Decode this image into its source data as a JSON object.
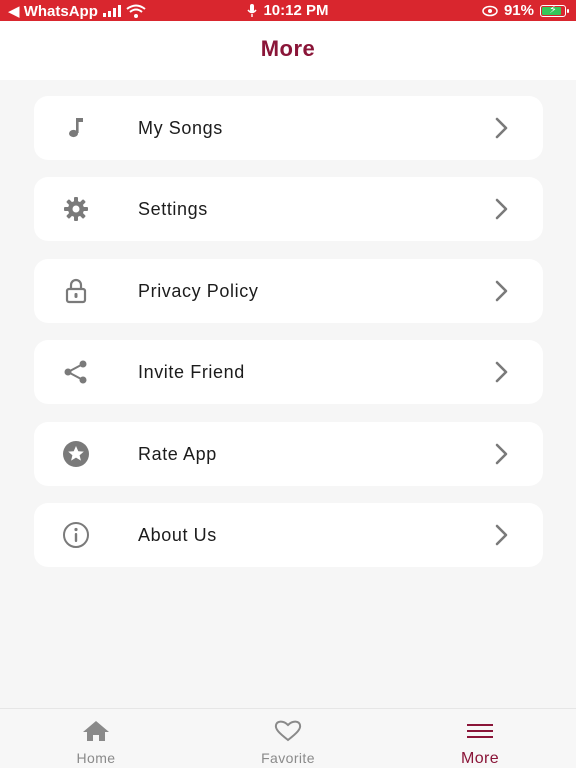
{
  "status_bar": {
    "back_app": "◀ WhatsApp",
    "time": "10:12 PM",
    "battery": "91%",
    "battery_level": 0.91
  },
  "header": {
    "title": "More"
  },
  "menu": {
    "items": [
      {
        "label": "My Songs",
        "icon": "music-note-icon"
      },
      {
        "label": "Settings",
        "icon": "gear-icon"
      },
      {
        "label": "Privacy Policy",
        "icon": "lock-icon"
      },
      {
        "label": "Invite Friend",
        "icon": "share-icon"
      },
      {
        "label": "Rate App",
        "icon": "star-icon"
      },
      {
        "label": "About Us",
        "icon": "info-icon"
      }
    ]
  },
  "tabs": [
    {
      "label": "Home",
      "icon": "home-icon",
      "active": false
    },
    {
      "label": "Favorite",
      "icon": "heart-icon",
      "active": false
    },
    {
      "label": "More",
      "icon": "menu-icon",
      "active": true
    }
  ],
  "colors": {
    "status_bar": "#d9262e",
    "accent": "#8a1538",
    "icon_gray": "#7a7a7a",
    "background": "#f6f6f6",
    "card": "#ffffff"
  }
}
